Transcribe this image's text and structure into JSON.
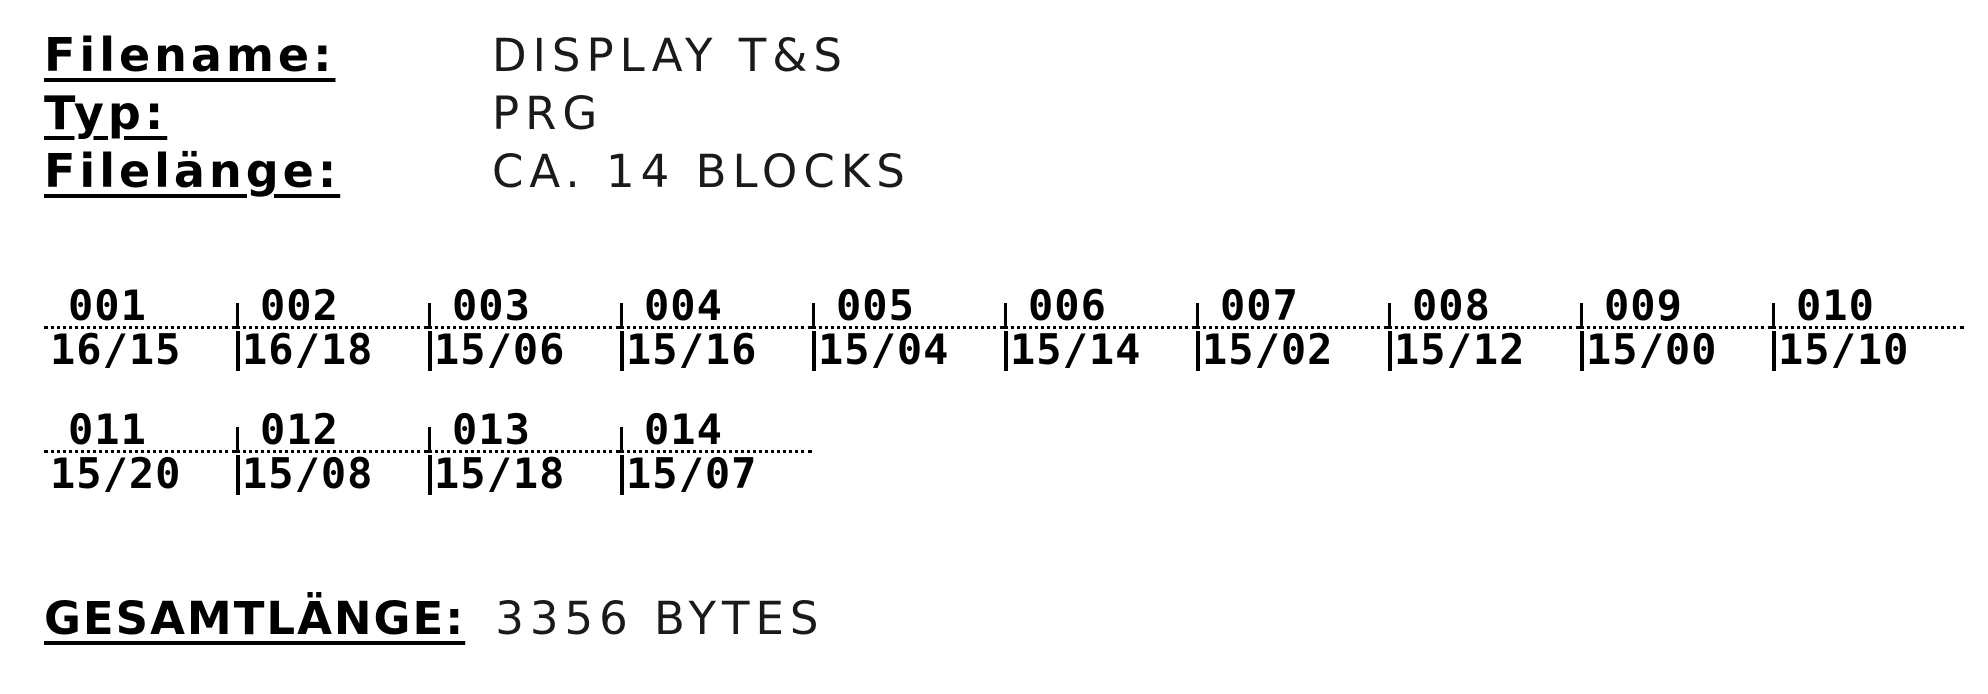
{
  "file_info": {
    "filename_label": "Filename:",
    "filename_value": "DISPLAY T&S",
    "type_label": "Typ:",
    "type_value": "PRG",
    "length_label": "Filelänge:",
    "length_value": "CA. 14 BLOCKS"
  },
  "blocks": [
    {
      "num": "001",
      "ts": "16/15"
    },
    {
      "num": "002",
      "ts": "16/18"
    },
    {
      "num": "003",
      "ts": "15/06"
    },
    {
      "num": "004",
      "ts": "15/16"
    },
    {
      "num": "005",
      "ts": "15/04"
    },
    {
      "num": "006",
      "ts": "15/14"
    },
    {
      "num": "007",
      "ts": "15/02"
    },
    {
      "num": "008",
      "ts": "15/12"
    },
    {
      "num": "009",
      "ts": "15/00"
    },
    {
      "num": "010",
      "ts": "15/10"
    },
    {
      "num": "011",
      "ts": "15/20"
    },
    {
      "num": "012",
      "ts": "15/08"
    },
    {
      "num": "013",
      "ts": "15/18"
    },
    {
      "num": "014",
      "ts": "15/07"
    }
  ],
  "total": {
    "label": "GESAMTLÄNGE:",
    "value": "3356 BYTES"
  }
}
